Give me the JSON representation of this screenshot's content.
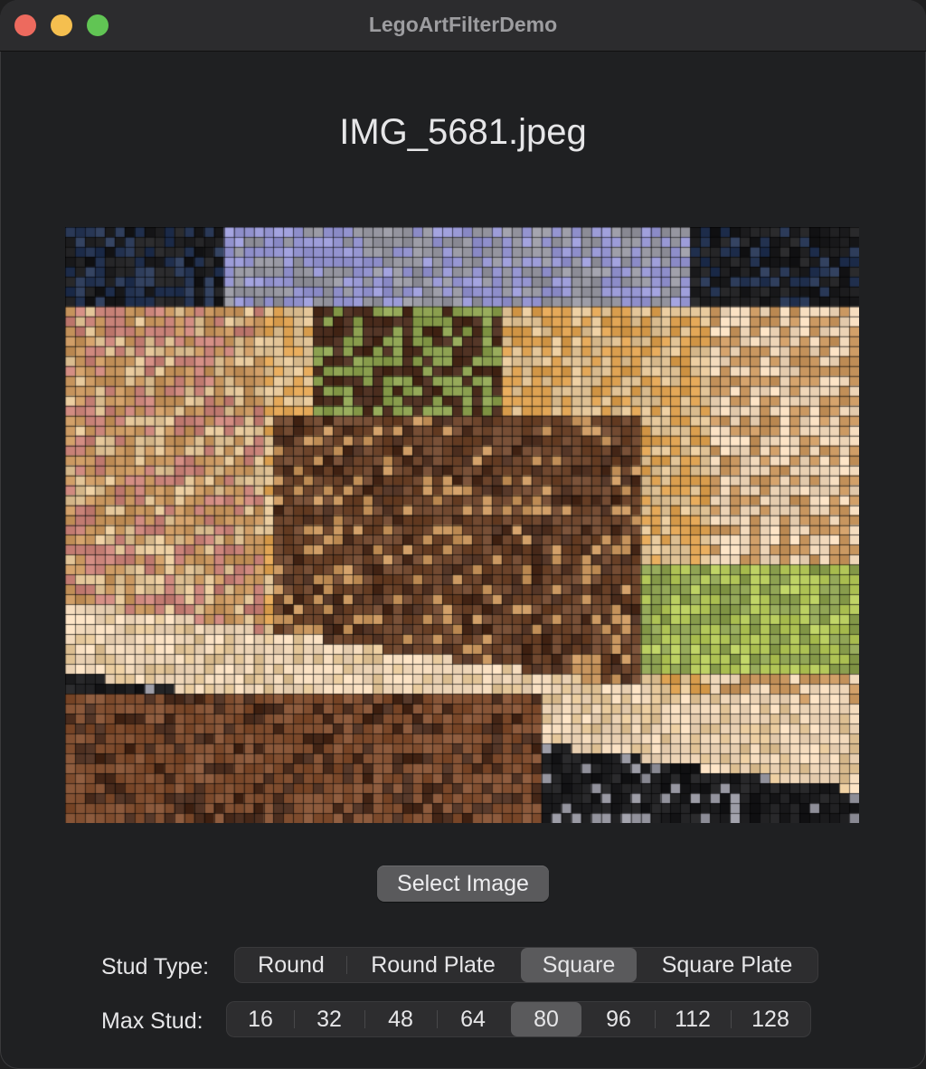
{
  "window": {
    "title": "LegoArtFilterDemo"
  },
  "image": {
    "filename": "IMG_5681.jpeg"
  },
  "select_button": {
    "label": "Select Image"
  },
  "stud_type": {
    "label": "Stud Type:",
    "options": [
      "Round",
      "Round Plate",
      "Square",
      "Square Plate"
    ],
    "selected": "Square"
  },
  "max_stud": {
    "label": "Max Stud:",
    "options": [
      "16",
      "32",
      "48",
      "64",
      "80",
      "96",
      "112",
      "128"
    ],
    "selected": "80"
  },
  "colors": {
    "window_bg": "#1f2022",
    "control_selected": "#5a5a5c",
    "text": "#e6e6e8"
  }
}
